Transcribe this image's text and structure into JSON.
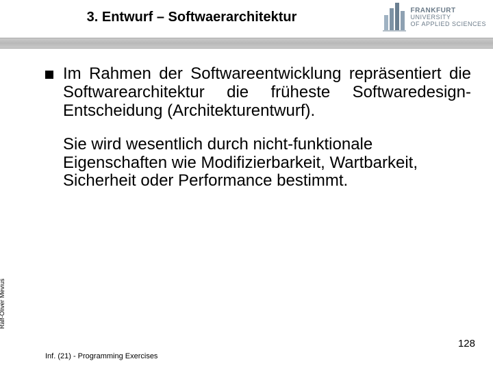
{
  "header": {
    "title": "3. Entwurf – Softwaerarchitektur",
    "logo": {
      "line1": "FRANKFURT",
      "line2": "UNIVERSITY",
      "line3": "OF APPLIED SCIENCES"
    }
  },
  "content": {
    "paragraph1": "Im Rahmen der Softwareentwicklung repräsentiert die Softwarearchitektur die früheste Softwaredesign-Entscheidung (Architekturentwurf).",
    "paragraph2": "Sie wird wesentlich durch nicht-funktionale Eigenschaften wie Modifizierbarkeit, Wartbarkeit, Sicherheit oder Performance bestimmt."
  },
  "sidelabel": "Ralf-Oliver Mevius",
  "footer": "Inf. (21) - Programming Exercises",
  "pagenum": "128"
}
